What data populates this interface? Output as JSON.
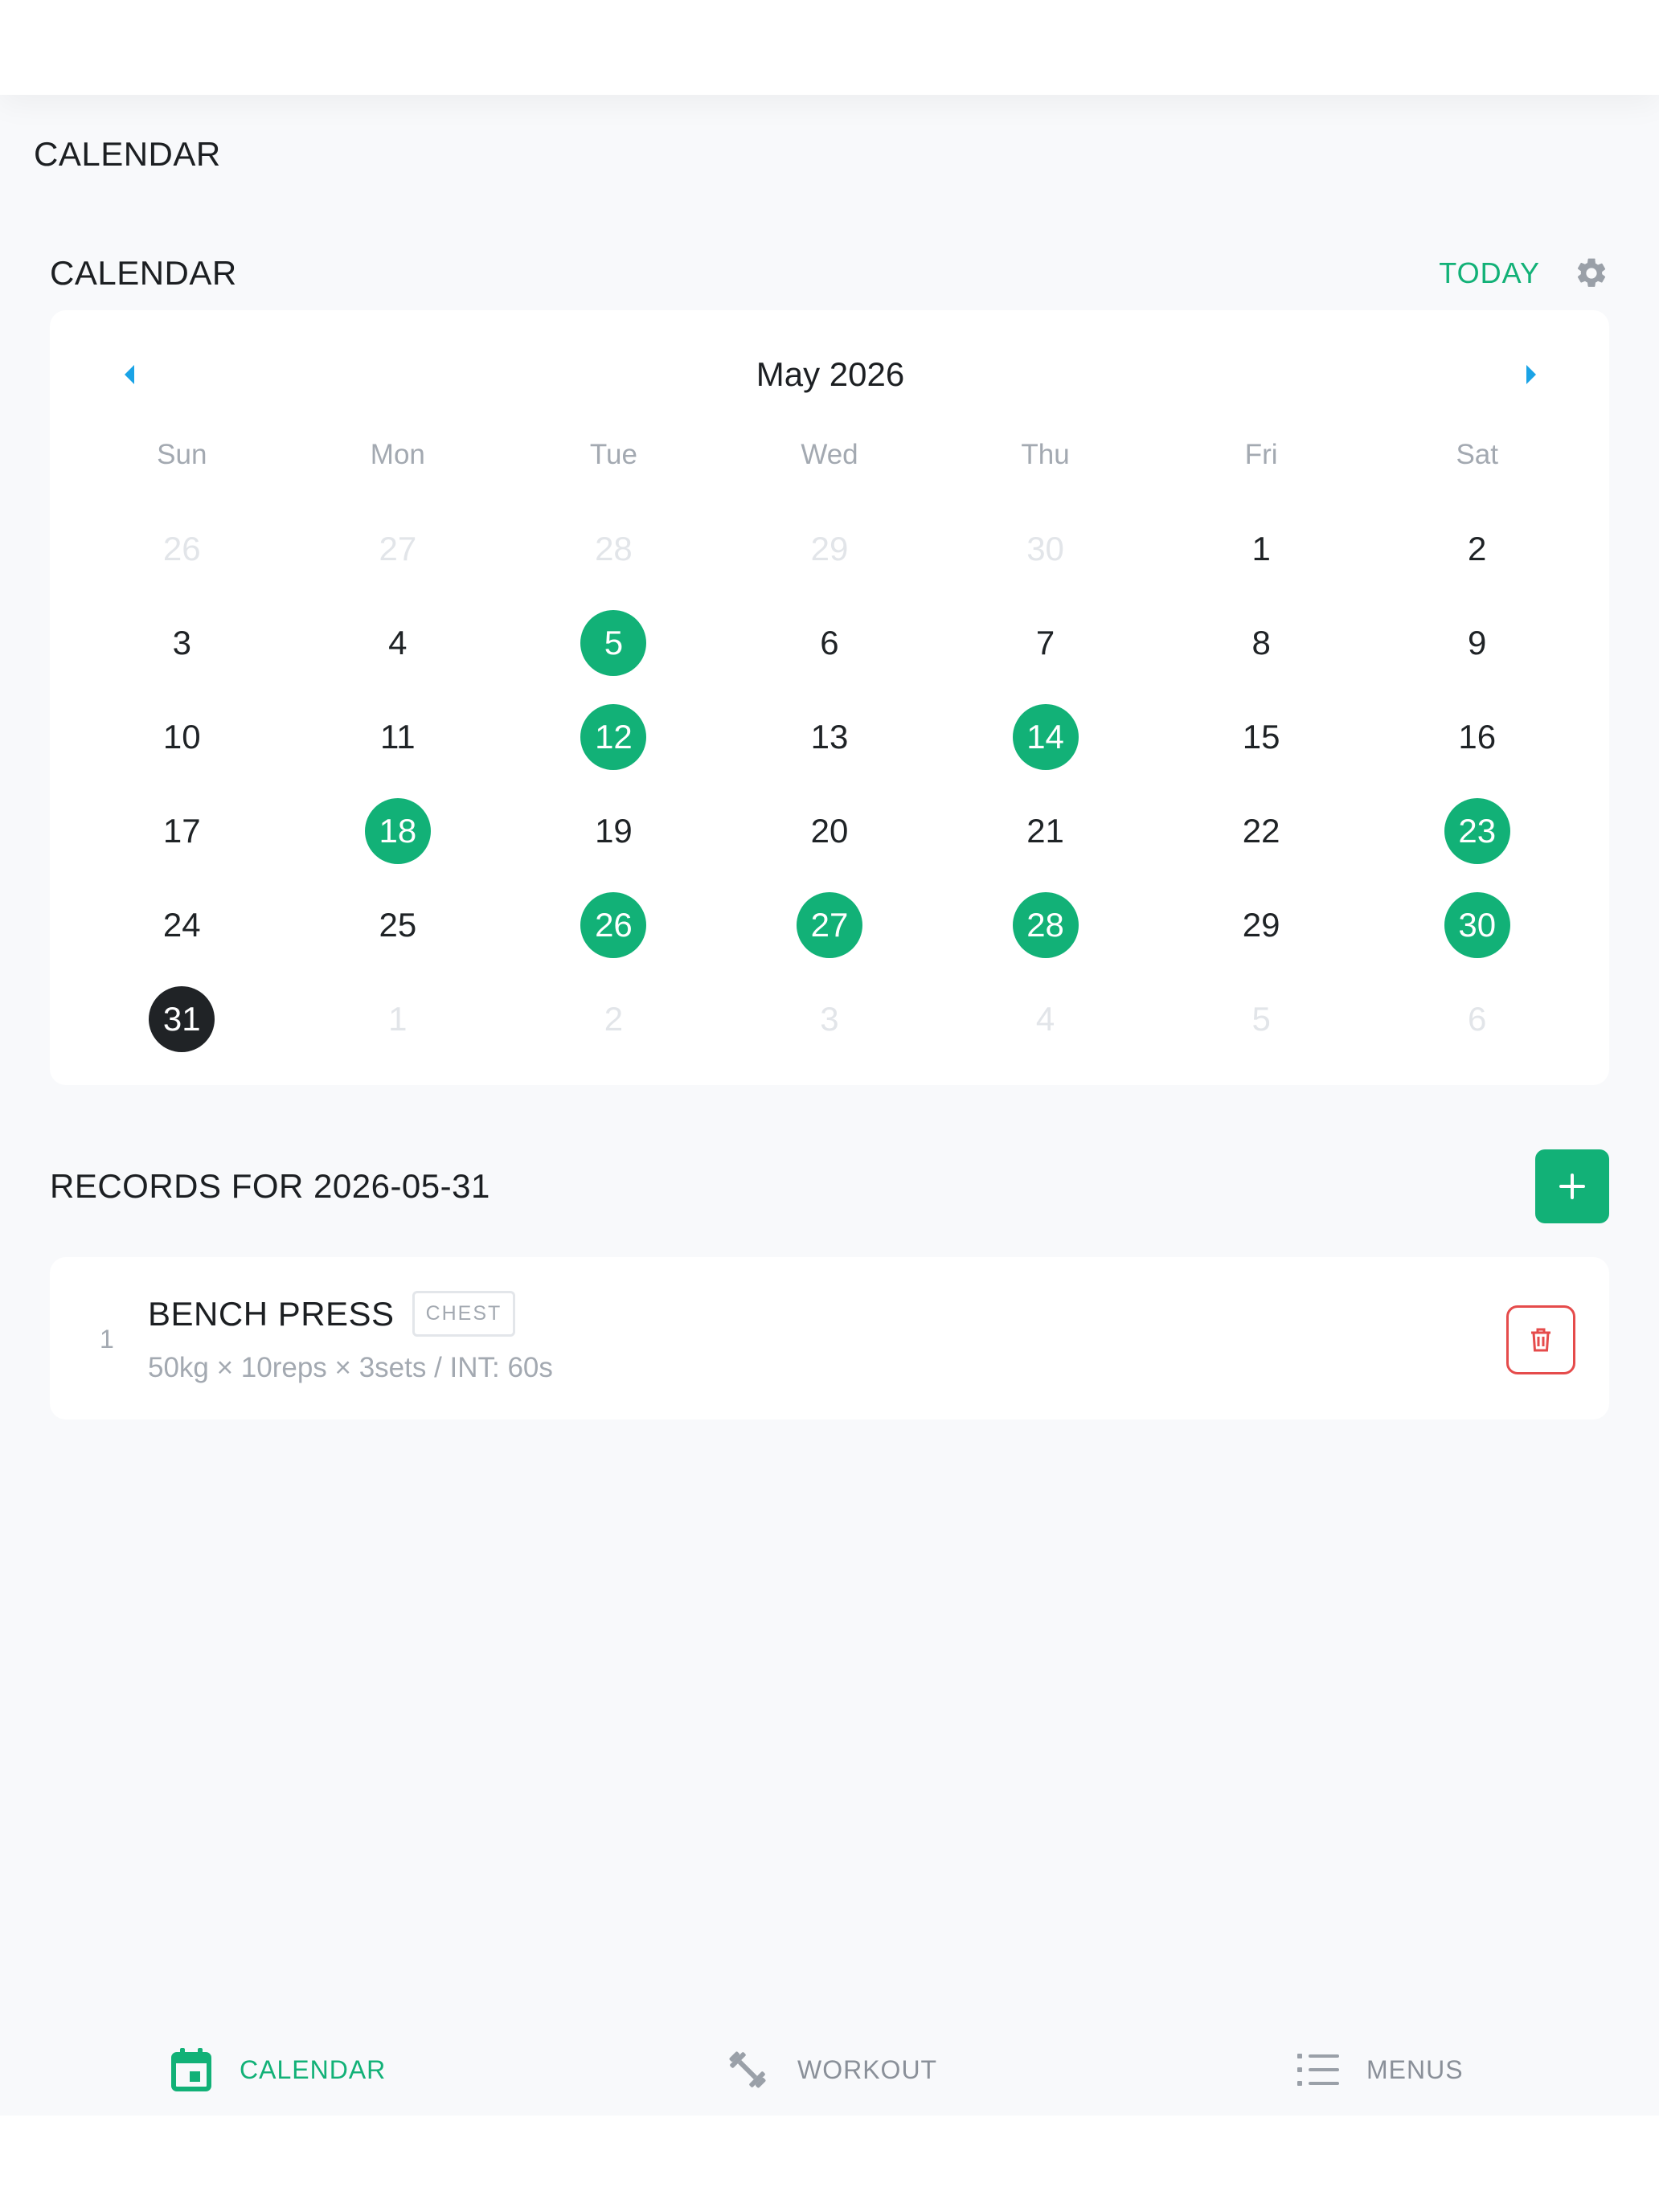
{
  "page": {
    "title": "CALENDAR"
  },
  "calendar": {
    "section_title": "CALENDAR",
    "today_label": "TODAY",
    "month_label": "May 2026",
    "weekdays": [
      "Sun",
      "Mon",
      "Tue",
      "Wed",
      "Thu",
      "Fri",
      "Sat"
    ],
    "days": [
      {
        "n": "26",
        "muted": true
      },
      {
        "n": "27",
        "muted": true
      },
      {
        "n": "28",
        "muted": true
      },
      {
        "n": "29",
        "muted": true
      },
      {
        "n": "30",
        "muted": true
      },
      {
        "n": "1"
      },
      {
        "n": "2"
      },
      {
        "n": "3"
      },
      {
        "n": "4"
      },
      {
        "n": "5",
        "marked": true
      },
      {
        "n": "6"
      },
      {
        "n": "7"
      },
      {
        "n": "8"
      },
      {
        "n": "9"
      },
      {
        "n": "10"
      },
      {
        "n": "11"
      },
      {
        "n": "12",
        "marked": true
      },
      {
        "n": "13"
      },
      {
        "n": "14",
        "marked": true
      },
      {
        "n": "15"
      },
      {
        "n": "16"
      },
      {
        "n": "17"
      },
      {
        "n": "18",
        "marked": true
      },
      {
        "n": "19"
      },
      {
        "n": "20"
      },
      {
        "n": "21"
      },
      {
        "n": "22"
      },
      {
        "n": "23",
        "marked": true
      },
      {
        "n": "24"
      },
      {
        "n": "25"
      },
      {
        "n": "26",
        "marked": true
      },
      {
        "n": "27",
        "marked": true
      },
      {
        "n": "28",
        "marked": true
      },
      {
        "n": "29"
      },
      {
        "n": "30",
        "marked": true
      },
      {
        "n": "31",
        "selected": true
      },
      {
        "n": "1",
        "muted": true
      },
      {
        "n": "2",
        "muted": true
      },
      {
        "n": "3",
        "muted": true
      },
      {
        "n": "4",
        "muted": true
      },
      {
        "n": "5",
        "muted": true
      },
      {
        "n": "6",
        "muted": true
      }
    ]
  },
  "records": {
    "title": "RECORDS FOR 2026-05-31",
    "items": [
      {
        "index": "1",
        "name": "BENCH PRESS",
        "tag": "CHEST",
        "detail": "50kg × 10reps × 3sets / INT: 60s"
      }
    ]
  },
  "tabs": {
    "calendar": "CALENDAR",
    "workout": "WORKOUT",
    "menus": "MENUS"
  },
  "colors": {
    "accent": "#12b177",
    "selected": "#202326",
    "danger": "#e54b4b",
    "nav_arrow": "#1aa3e6"
  }
}
